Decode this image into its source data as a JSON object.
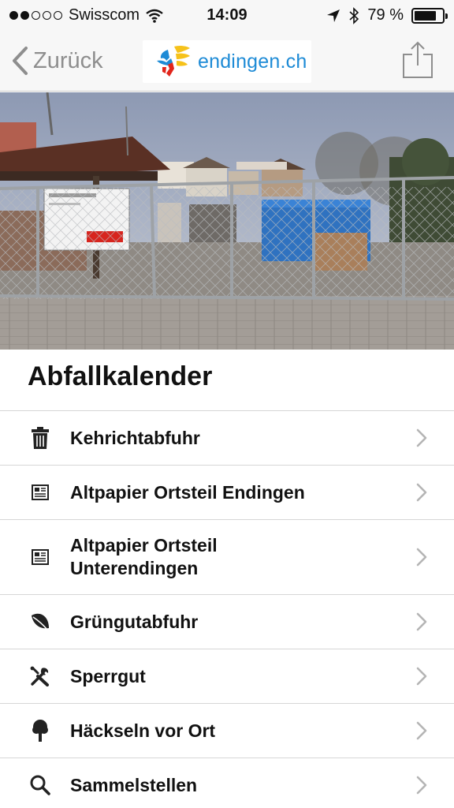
{
  "statusbar": {
    "carrier": "Swisscom",
    "signal_filled": 2,
    "signal_total": 5,
    "time": "14:09",
    "battery_text": "79 %",
    "battery_level": 0.79
  },
  "navbar": {
    "back_label": "Zurück",
    "logo_text": "endingen.ch",
    "share_icon": "share-icon"
  },
  "main": {
    "section_title": "Abfallkalender"
  },
  "list": [
    {
      "icon": "trash-icon",
      "label": "Kehrichtabfuhr"
    },
    {
      "icon": "newspaper-icon",
      "label": "Altpapier Ortsteil Endingen"
    },
    {
      "icon": "newspaper-icon",
      "label": "Altpapier Ortsteil Unterendingen"
    },
    {
      "icon": "leaf-icon",
      "label": "Grüngutabfuhr"
    },
    {
      "icon": "tools-icon",
      "label": "Sperrgut"
    },
    {
      "icon": "tree-icon",
      "label": "Häckseln vor Ort"
    },
    {
      "icon": "search-icon",
      "label": "Sammelstellen"
    }
  ],
  "colors": {
    "accent_blue": "#1e8bd6",
    "back_gray": "#8e8e8e",
    "bar_bg": "#f7f7f7"
  }
}
